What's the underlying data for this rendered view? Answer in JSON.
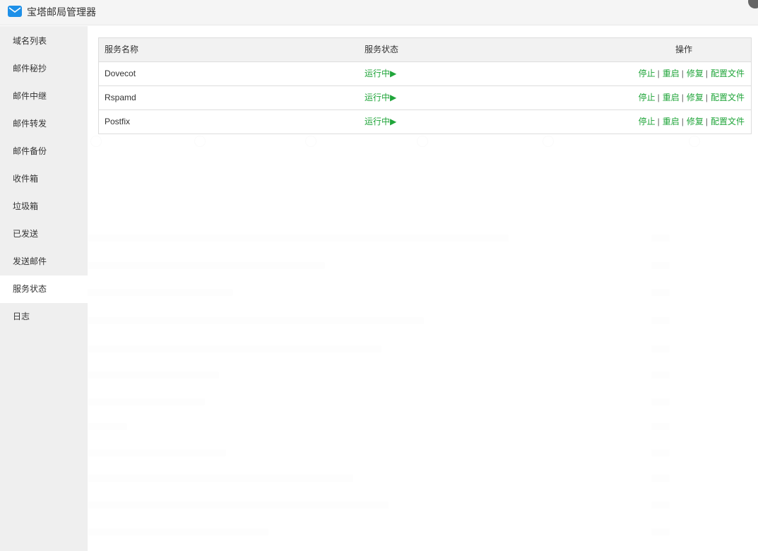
{
  "window": {
    "title": "宝塔邮局管理器"
  },
  "sidebar": {
    "items": [
      {
        "label": "域名列表"
      },
      {
        "label": "邮件秘抄"
      },
      {
        "label": "邮件中继"
      },
      {
        "label": "邮件转发"
      },
      {
        "label": "邮件备份"
      },
      {
        "label": "收件箱"
      },
      {
        "label": "垃圾箱"
      },
      {
        "label": "已发送"
      },
      {
        "label": "发送邮件"
      },
      {
        "label": "服务状态",
        "active": true
      },
      {
        "label": "日志"
      }
    ]
  },
  "service_table": {
    "headers": {
      "name": "服务名称",
      "status": "服务状态",
      "ops": "操作"
    },
    "rows": [
      {
        "name": "Dovecot",
        "status": "运行中▶",
        "ops": [
          "停止",
          "重启",
          "修复",
          "配置文件"
        ]
      },
      {
        "name": "Rspamd",
        "status": "运行中▶",
        "ops": [
          "停止",
          "重启",
          "修复",
          "配置文件"
        ]
      },
      {
        "name": "Postfix",
        "status": "运行中▶",
        "ops": [
          "停止",
          "重启",
          "修复",
          "配置文件"
        ]
      }
    ],
    "separator": "|"
  },
  "colors": {
    "accent_green": "#20a53a",
    "title_icon_blue": "#1e90e8"
  }
}
